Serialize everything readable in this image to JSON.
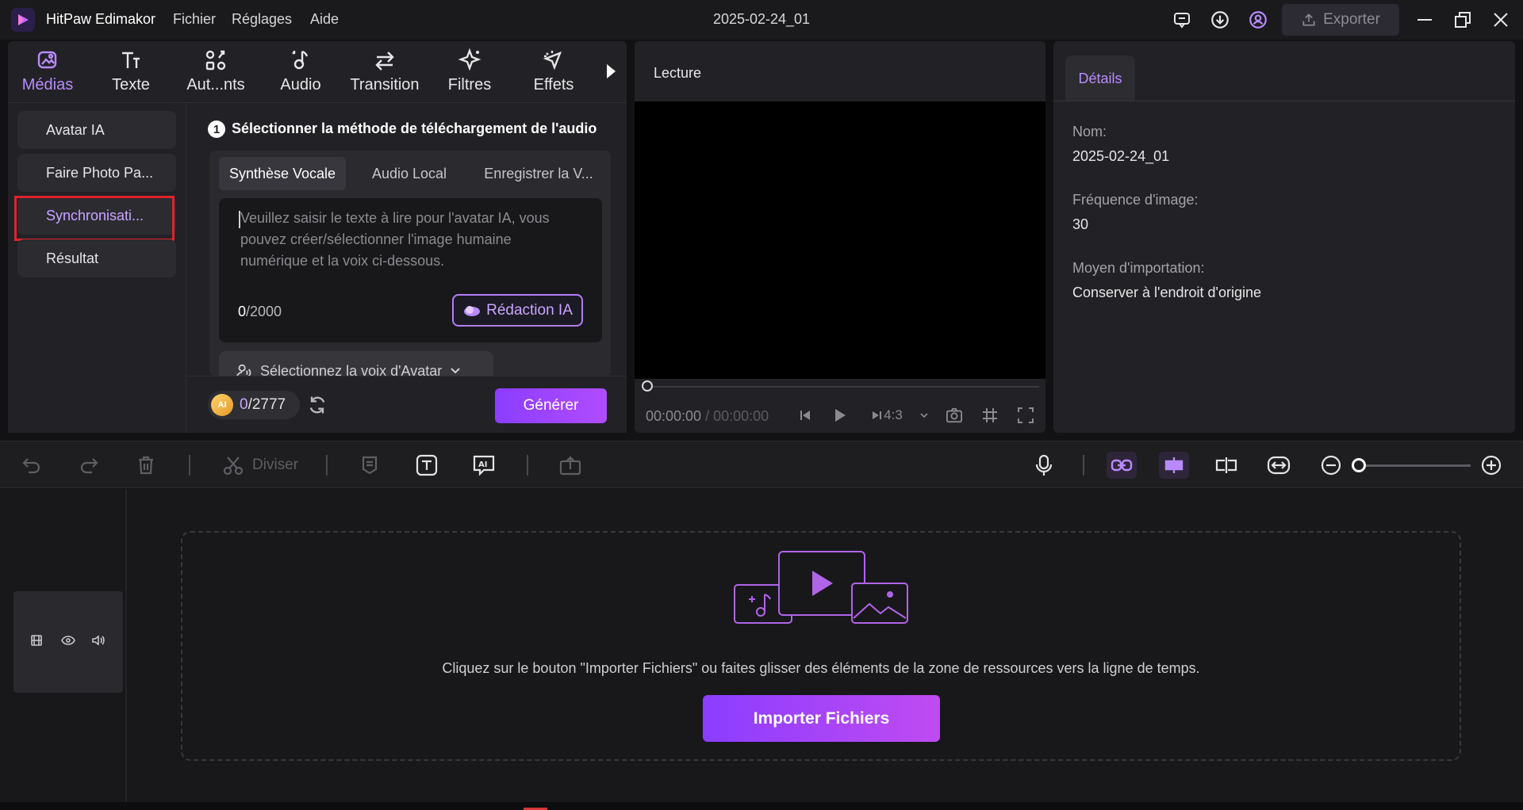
{
  "titlebar": {
    "app_name": "HitPaw Edimakor",
    "menu": [
      "Fichier",
      "Réglages",
      "Aide"
    ],
    "title": "2025-02-24_01",
    "export_label": "Exporter"
  },
  "tool_tabs": [
    {
      "label": "Médias",
      "icon": "media-icon",
      "active": true
    },
    {
      "label": "Texte",
      "icon": "text-icon"
    },
    {
      "label": "Aut...nts",
      "icon": "elements-icon"
    },
    {
      "label": "Audio",
      "icon": "audio-icon"
    },
    {
      "label": "Transition",
      "icon": "transition-icon"
    },
    {
      "label": "Filtres",
      "icon": "filters-icon"
    },
    {
      "label": "Effets",
      "icon": "effects-icon"
    }
  ],
  "side_nav": [
    {
      "label": "Avatar IA"
    },
    {
      "label": "Faire Photo Pa..."
    },
    {
      "label": "Synchronisati...",
      "active": true
    },
    {
      "label": "Résultat"
    }
  ],
  "step": {
    "number": "1",
    "title": "Sélectionner la méthode de téléchargement de l'audio"
  },
  "audio_tabs": [
    "Synthèse Vocale",
    "Audio Local",
    "Enregistrer la V..."
  ],
  "text_input": {
    "placeholder": "Veuillez saisir le texte à lire pour l'avatar IA, vous pouvez créer/sélectionner l'image humaine numérique et la voix ci-dessous.",
    "count_current": "0",
    "count_max": "/2000"
  },
  "ai_write_label": "Rédaction IA",
  "voice_select_label": "Sélectionnez la voix d'Avatar",
  "credits": {
    "coin_label": "AI",
    "current": "0",
    "total": "/2777"
  },
  "generate_label": "Générer",
  "preview": {
    "title": "Lecture",
    "timecode_current": "00:00:00",
    "timecode_total": " / 00:00:00",
    "ratio": "4:3"
  },
  "details": {
    "tab_label": "Détails",
    "fields": [
      {
        "label": "Nom:",
        "value": "2025-02-24_01"
      },
      {
        "label": "Fréquence d'image:",
        "value": "30"
      },
      {
        "label": "Moyen d'importation:",
        "value": "Conserver à l'endroit d'origine"
      }
    ]
  },
  "timeline": {
    "split_label": "Diviser",
    "drop_text": "Cliquez sur le bouton \"Importer Fichiers\" ou faites glisser des éléments de la zone de ressources vers la ligne de temps.",
    "import_label": "Importer Fichiers",
    "zoom_level": 0
  },
  "colors": {
    "accent": "#a855f7",
    "highlight_border": "#e0242c",
    "background": "#121214"
  }
}
